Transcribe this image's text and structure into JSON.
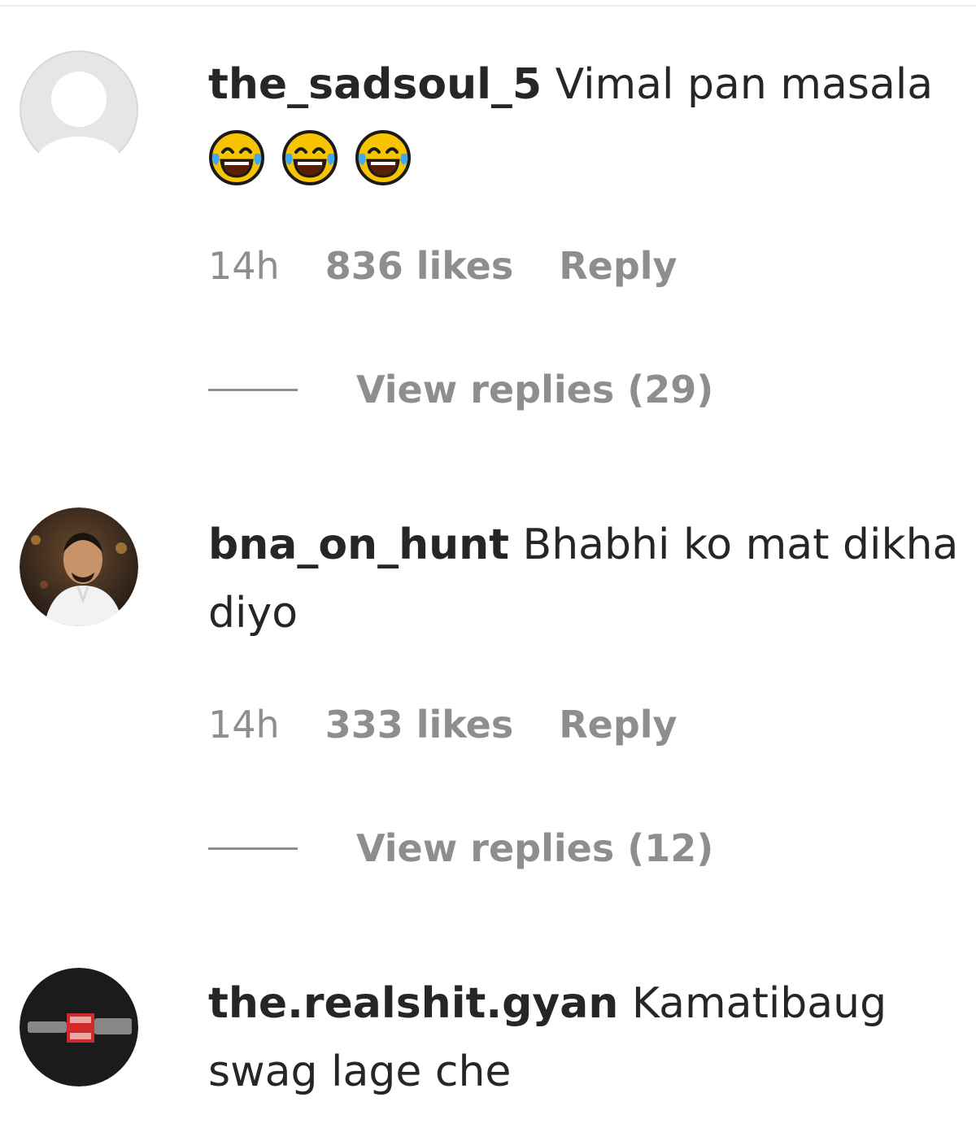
{
  "comments": [
    {
      "username": "the_sadsoul_5",
      "text": "Vimal pan masala",
      "emoji": [
        "laughing-tears-emoji",
        "laughing-tears-emoji",
        "laughing-tears-emoji"
      ],
      "time": "14h",
      "likes": "836 likes",
      "reply_label": "Reply",
      "view_replies": "View replies (29)"
    },
    {
      "username": "bna_on_hunt",
      "text": "Bhabhi ko mat dikha diyo",
      "time": "14h",
      "likes": "333 likes",
      "reply_label": "Reply",
      "view_replies": "View replies (12)"
    },
    {
      "username": "the.realshit.gyan",
      "text": "Kamatibaug swag lage che"
    }
  ],
  "colors": {
    "text": "#262626",
    "secondary": "#8e8e8e",
    "divider": "#ebebeb",
    "emoji_face": "#f7c400",
    "emoji_tear": "#3fa9f5"
  }
}
